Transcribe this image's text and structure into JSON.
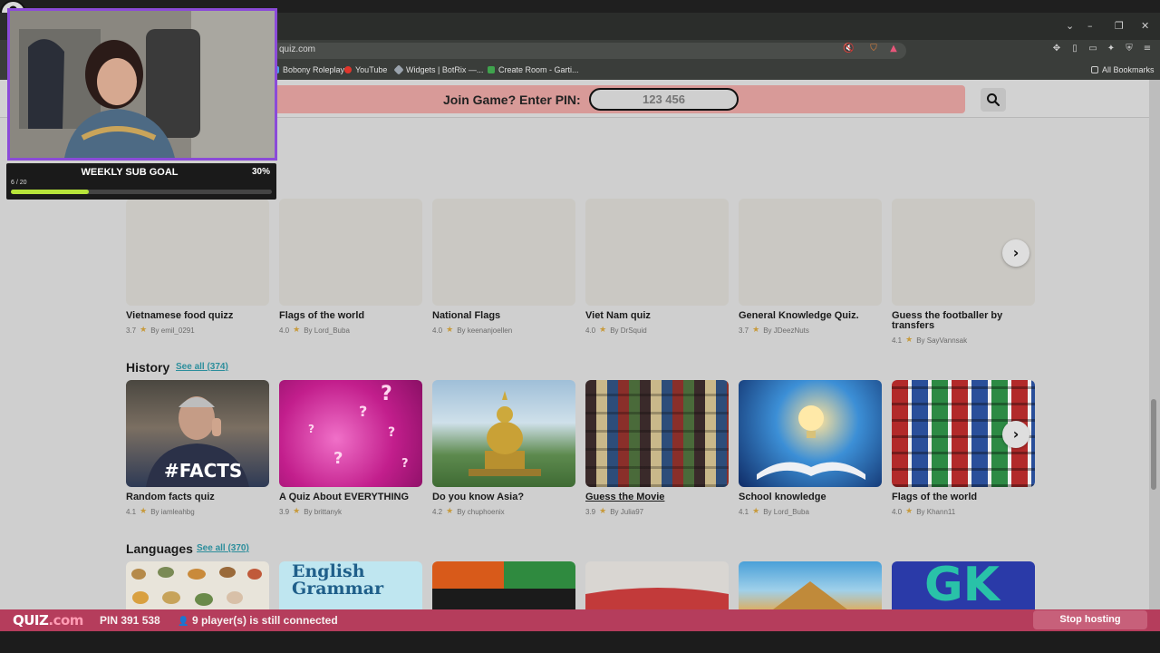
{
  "browser": {
    "url_partial": "quiz.com",
    "bookmarks": [
      {
        "label": "Bobony Roleplay",
        "color": "#4c9be8"
      },
      {
        "label": "YouTube",
        "color": "#e0352b"
      },
      {
        "label": "Widgets | BotRix —...",
        "color": "#9aa3ad"
      },
      {
        "label": "Create Room - Garti...",
        "color": "#3fa34d"
      }
    ],
    "all_bookmarks": "All Bookmarks"
  },
  "header": {
    "join_label": "Join Game? Enter PIN:",
    "pin_placeholder": "123 456"
  },
  "top_row": {
    "cards": [
      {
        "title": "Vietnamese food quizz",
        "rating": "3.7",
        "author": "By emil_0291"
      },
      {
        "title": "Flags of the world",
        "rating": "4.0",
        "author": "By Lord_Buba"
      },
      {
        "title": "National Flags",
        "rating": "4.0",
        "author": "By keenanjoellen"
      },
      {
        "title": "Viet Nam quiz",
        "rating": "4.0",
        "author": "By DrSquid"
      },
      {
        "title": "General Knowledge Quiz.",
        "rating": "3.7",
        "author": "By JDeezNuts"
      },
      {
        "title": "Guess the footballer by transfers",
        "rating": "4.1",
        "author": "By SayVannsak"
      }
    ]
  },
  "history": {
    "title": "History",
    "see_all": "See all (374)",
    "cards": [
      {
        "title": "Random facts quiz",
        "rating": "4.1",
        "author": "By iamleahbg",
        "overlay": "#FACTS"
      },
      {
        "title": "A Quiz About EVERYTHING",
        "rating": "3.9",
        "author": "By brittanyk"
      },
      {
        "title": "Do you know Asia?",
        "rating": "4.2",
        "author": "By chuphoenix"
      },
      {
        "title": "Guess the Movie",
        "rating": "3.9",
        "author": "By Julia97"
      },
      {
        "title": "School knowledge",
        "rating": "4.1",
        "author": "By Lord_Buba"
      },
      {
        "title": "Flags of the world",
        "rating": "4.0",
        "author": "By Khann11"
      }
    ]
  },
  "languages": {
    "title": "Languages",
    "see_all": "See all (370)",
    "grammar_text": "English Grammar",
    "gk_text": "GK"
  },
  "hosting_bar": {
    "logo_main": "QUIZ",
    "logo_suffix": ".com",
    "pin": "PIN 391 538",
    "players": "9 player(s) is still connected",
    "stop_button": "Stop hosting"
  },
  "overlay": {
    "goal_title": "WEEKLY SUB GOAL",
    "goal_percent": "30%",
    "goal_count": "6 / 20",
    "goal_progress": 0.3
  }
}
